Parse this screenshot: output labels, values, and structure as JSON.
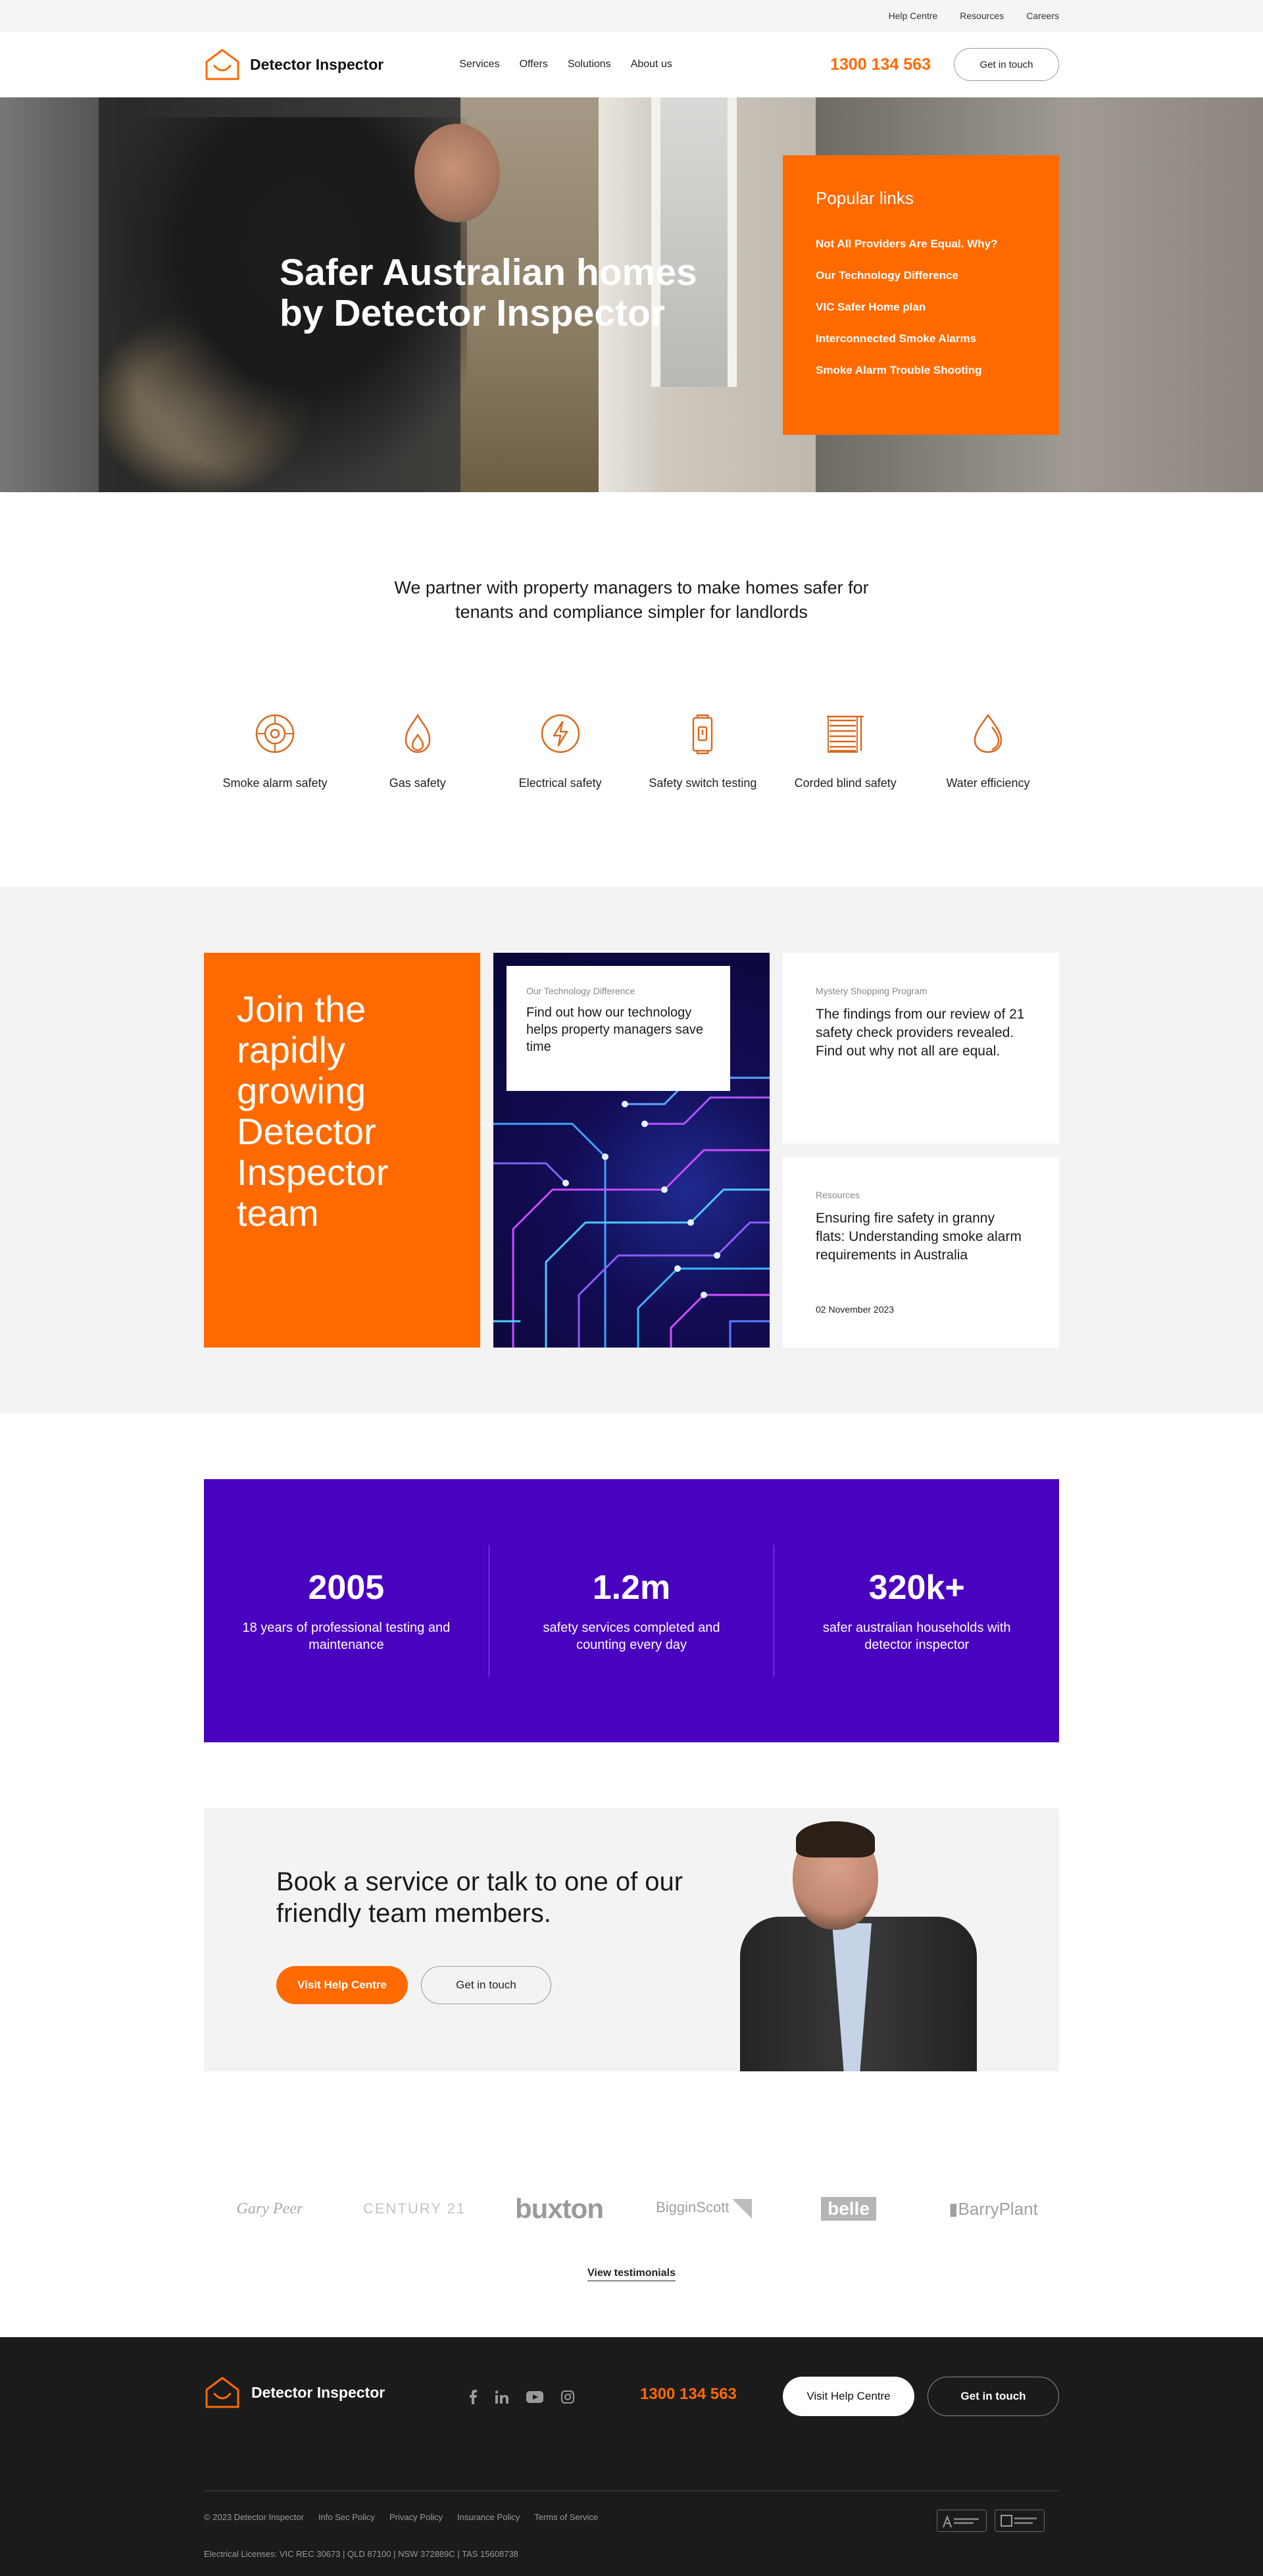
{
  "utility_nav": [
    "Help Centre",
    "Resources",
    "Careers"
  ],
  "brand": {
    "name": "Detector Inspector",
    "accent": "#ff6a00",
    "purple": "#4a02c1"
  },
  "header": {
    "nav": [
      "Services",
      "Offers",
      "Solutions",
      "About us"
    ],
    "phone": "1300 134 563",
    "cta": "Get in touch"
  },
  "hero": {
    "title": "Safer Australian homes by Detector Inspector",
    "popular_title": "Popular links",
    "popular_links": [
      "Not All Providers Are Equal. Why?",
      "Our Technology Difference",
      "VIC Safer Home plan",
      "Interconnected Smoke Alarms",
      "Smoke Alarm Trouble Shooting"
    ]
  },
  "intro": {
    "text": "We partner with property managers to make homes safer for tenants and compliance simpler for landlords"
  },
  "services": [
    {
      "label": "Smoke alarm safety",
      "icon": "smoke-alarm-icon"
    },
    {
      "label": "Gas safety",
      "icon": "flame-icon"
    },
    {
      "label": "Electrical safety",
      "icon": "lightning-icon"
    },
    {
      "label": "Safety switch testing",
      "icon": "safety-switch-icon"
    },
    {
      "label": "Corded blind safety",
      "icon": "blind-icon"
    },
    {
      "label": "Water efficiency",
      "icon": "water-drop-icon"
    }
  ],
  "cards": {
    "join": "Join the rapidly growing Detector Inspector team",
    "tech": {
      "tag": "Our Technology Difference",
      "text": "Find out how our technology helps property managers save time"
    },
    "mystery": {
      "tag": "Mystery Shopping Program",
      "text": "The findings from our review of 21 safety check providers revealed. Find out why not all are equal."
    },
    "resources": {
      "tag": "Resources",
      "text": "Ensuring fire safety in granny flats: Understanding smoke alarm requirements in Australia",
      "date": "02 November 2023"
    }
  },
  "stats": [
    {
      "num": "2005",
      "text": "18 years of professional testing and maintenance"
    },
    {
      "num": "1.2m",
      "text": "safety services completed and counting every day"
    },
    {
      "num": "320k+",
      "text": "safer australian households with detector inspector"
    }
  ],
  "book": {
    "title": "Book a service or talk to one of our friendly team members.",
    "primary": "Visit Help Centre",
    "secondary": "Get in touch"
  },
  "partner_logos": [
    "Gary Peer",
    "CENTURY 21",
    "buxton",
    "BigginScott",
    "belle",
    "BarryPlant"
  ],
  "testimonials_link": "View testimonials",
  "footer": {
    "brand": "Detector Inspector",
    "social": [
      "facebook-icon",
      "linkedin-icon",
      "youtube-icon",
      "instagram-icon"
    ],
    "phone": "1300 134 563",
    "primary": "Visit Help Centre",
    "secondary": "Get in touch",
    "legal": [
      "© 2023 Detector Inspector",
      "Info Sec Policy",
      "Privacy Policy",
      "Insurance Policy",
      "Terms of Service"
    ],
    "licenses": "Electrical Licenses: VIC REC 30673 | QLD 87100 | NSW 372889C | TAS 15608738"
  }
}
